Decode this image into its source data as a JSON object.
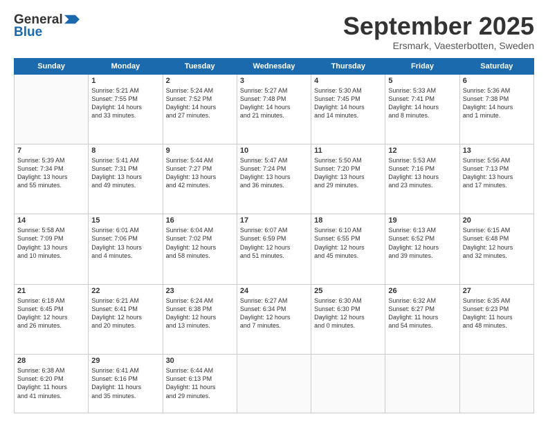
{
  "header": {
    "logo_line1": "General",
    "logo_line2": "Blue",
    "month": "September 2025",
    "location": "Ersmark, Vaesterbotten, Sweden"
  },
  "days_of_week": [
    "Sunday",
    "Monday",
    "Tuesday",
    "Wednesday",
    "Thursday",
    "Friday",
    "Saturday"
  ],
  "weeks": [
    [
      {
        "day": "",
        "content": ""
      },
      {
        "day": "1",
        "content": "Sunrise: 5:21 AM\nSunset: 7:55 PM\nDaylight: 14 hours\nand 33 minutes."
      },
      {
        "day": "2",
        "content": "Sunrise: 5:24 AM\nSunset: 7:52 PM\nDaylight: 14 hours\nand 27 minutes."
      },
      {
        "day": "3",
        "content": "Sunrise: 5:27 AM\nSunset: 7:48 PM\nDaylight: 14 hours\nand 21 minutes."
      },
      {
        "day": "4",
        "content": "Sunrise: 5:30 AM\nSunset: 7:45 PM\nDaylight: 14 hours\nand 14 minutes."
      },
      {
        "day": "5",
        "content": "Sunrise: 5:33 AM\nSunset: 7:41 PM\nDaylight: 14 hours\nand 8 minutes."
      },
      {
        "day": "6",
        "content": "Sunrise: 5:36 AM\nSunset: 7:38 PM\nDaylight: 14 hours\nand 1 minute."
      }
    ],
    [
      {
        "day": "7",
        "content": "Sunrise: 5:39 AM\nSunset: 7:34 PM\nDaylight: 13 hours\nand 55 minutes."
      },
      {
        "day": "8",
        "content": "Sunrise: 5:41 AM\nSunset: 7:31 PM\nDaylight: 13 hours\nand 49 minutes."
      },
      {
        "day": "9",
        "content": "Sunrise: 5:44 AM\nSunset: 7:27 PM\nDaylight: 13 hours\nand 42 minutes."
      },
      {
        "day": "10",
        "content": "Sunrise: 5:47 AM\nSunset: 7:24 PM\nDaylight: 13 hours\nand 36 minutes."
      },
      {
        "day": "11",
        "content": "Sunrise: 5:50 AM\nSunset: 7:20 PM\nDaylight: 13 hours\nand 29 minutes."
      },
      {
        "day": "12",
        "content": "Sunrise: 5:53 AM\nSunset: 7:16 PM\nDaylight: 13 hours\nand 23 minutes."
      },
      {
        "day": "13",
        "content": "Sunrise: 5:56 AM\nSunset: 7:13 PM\nDaylight: 13 hours\nand 17 minutes."
      }
    ],
    [
      {
        "day": "14",
        "content": "Sunrise: 5:58 AM\nSunset: 7:09 PM\nDaylight: 13 hours\nand 10 minutes."
      },
      {
        "day": "15",
        "content": "Sunrise: 6:01 AM\nSunset: 7:06 PM\nDaylight: 13 hours\nand 4 minutes."
      },
      {
        "day": "16",
        "content": "Sunrise: 6:04 AM\nSunset: 7:02 PM\nDaylight: 12 hours\nand 58 minutes."
      },
      {
        "day": "17",
        "content": "Sunrise: 6:07 AM\nSunset: 6:59 PM\nDaylight: 12 hours\nand 51 minutes."
      },
      {
        "day": "18",
        "content": "Sunrise: 6:10 AM\nSunset: 6:55 PM\nDaylight: 12 hours\nand 45 minutes."
      },
      {
        "day": "19",
        "content": "Sunrise: 6:13 AM\nSunset: 6:52 PM\nDaylight: 12 hours\nand 39 minutes."
      },
      {
        "day": "20",
        "content": "Sunrise: 6:15 AM\nSunset: 6:48 PM\nDaylight: 12 hours\nand 32 minutes."
      }
    ],
    [
      {
        "day": "21",
        "content": "Sunrise: 6:18 AM\nSunset: 6:45 PM\nDaylight: 12 hours\nand 26 minutes."
      },
      {
        "day": "22",
        "content": "Sunrise: 6:21 AM\nSunset: 6:41 PM\nDaylight: 12 hours\nand 20 minutes."
      },
      {
        "day": "23",
        "content": "Sunrise: 6:24 AM\nSunset: 6:38 PM\nDaylight: 12 hours\nand 13 minutes."
      },
      {
        "day": "24",
        "content": "Sunrise: 6:27 AM\nSunset: 6:34 PM\nDaylight: 12 hours\nand 7 minutes."
      },
      {
        "day": "25",
        "content": "Sunrise: 6:30 AM\nSunset: 6:30 PM\nDaylight: 12 hours\nand 0 minutes."
      },
      {
        "day": "26",
        "content": "Sunrise: 6:32 AM\nSunset: 6:27 PM\nDaylight: 11 hours\nand 54 minutes."
      },
      {
        "day": "27",
        "content": "Sunrise: 6:35 AM\nSunset: 6:23 PM\nDaylight: 11 hours\nand 48 minutes."
      }
    ],
    [
      {
        "day": "28",
        "content": "Sunrise: 6:38 AM\nSunset: 6:20 PM\nDaylight: 11 hours\nand 41 minutes."
      },
      {
        "day": "29",
        "content": "Sunrise: 6:41 AM\nSunset: 6:16 PM\nDaylight: 11 hours\nand 35 minutes."
      },
      {
        "day": "30",
        "content": "Sunrise: 6:44 AM\nSunset: 6:13 PM\nDaylight: 11 hours\nand 29 minutes."
      },
      {
        "day": "",
        "content": ""
      },
      {
        "day": "",
        "content": ""
      },
      {
        "day": "",
        "content": ""
      },
      {
        "day": "",
        "content": ""
      }
    ]
  ]
}
